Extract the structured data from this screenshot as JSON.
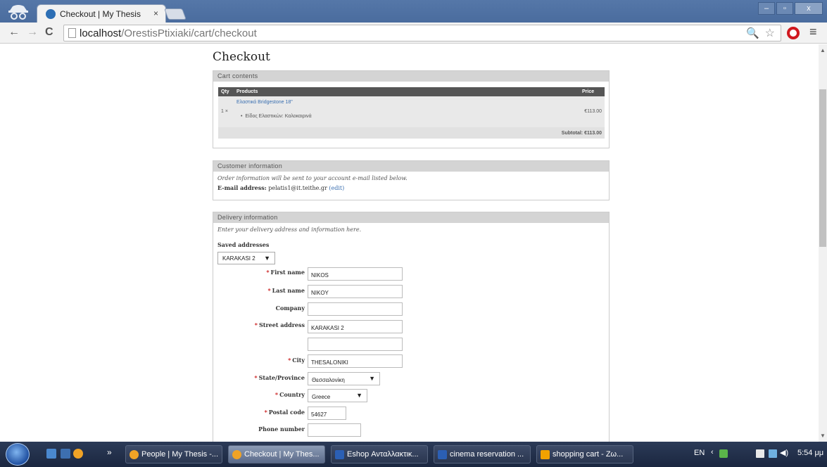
{
  "browser": {
    "tab_title": "Checkout | My Thesis",
    "tab_close": "×",
    "url_host": "localhost",
    "url_path": "/OrestisPtixiaki/cart/checkout",
    "back": "←",
    "forward": "→",
    "reload": "C",
    "search_icon": "🔍",
    "star_icon": "☆",
    "menu_icon": "≡",
    "win_min": "–",
    "win_max": "▫",
    "win_close": "x"
  },
  "page": {
    "title": "Checkout",
    "cart": {
      "legend": "Cart contents",
      "headers": {
        "qty": "Qty",
        "products": "Products",
        "price": "Price"
      },
      "item": {
        "qty": "1 ×",
        "product_name": "Ελαστικά Bridgestone 18\"",
        "attribute": "Είδος Ελαστικών: Καλοκαιρινά",
        "price": "€113.00"
      },
      "subtotal": "Subtotal: €113.00"
    },
    "customer": {
      "legend": "Customer information",
      "intro": "Order information will be sent to your account e-mail listed below.",
      "email_label": "E-mail address:",
      "email_value": "pelatis1@it.teithe.gr",
      "edit_link": "(edit)"
    },
    "delivery": {
      "legend": "Delivery information",
      "intro": "Enter your delivery address and information here.",
      "saved_label": "Saved addresses",
      "saved_value": "KARAKASI 2",
      "required_mark": "*",
      "fields": {
        "first_name": {
          "label": "First name",
          "value": "NIKOS"
        },
        "last_name": {
          "label": "Last name",
          "value": "NIKOY"
        },
        "company": {
          "label": "Company",
          "value": ""
        },
        "street": {
          "label": "Street address",
          "value": "KARAKASI 2"
        },
        "street2": {
          "value": ""
        },
        "city": {
          "label": "City",
          "value": "THESALONIKI"
        },
        "state": {
          "label": "State/Province",
          "value": "Θεσσαλονίκη"
        },
        "country": {
          "label": "Country",
          "value": "Greece"
        },
        "postal": {
          "label": "Postal code",
          "value": "54627"
        },
        "phone": {
          "label": "Phone number",
          "value": ""
        }
      },
      "dropdown_arrow": "▼"
    }
  },
  "taskbar": {
    "overflow": "»",
    "tasks": [
      "People | My Thesis -...",
      "Checkout | My Thes...",
      "Eshop Ανταλλακτικ...",
      "cinema reservation ...",
      "shopping cart - Ζω..."
    ],
    "tray": "EN",
    "clock": "5:54 μμ",
    "colors": {
      "chrome": "#f0a326",
      "word": "#2b5fb4",
      "vlc": "#f2a200"
    }
  }
}
